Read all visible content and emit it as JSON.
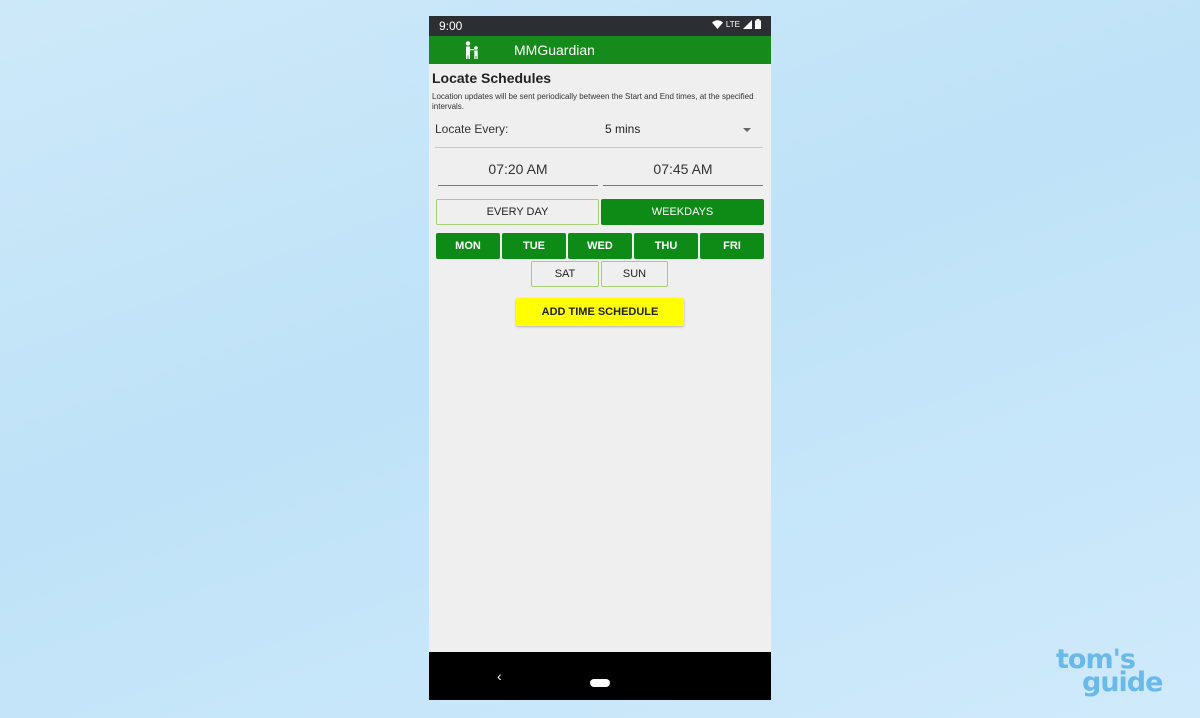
{
  "status_bar": {
    "time": "9:00",
    "network": "LTE"
  },
  "app_bar": {
    "title": "MMGuardian",
    "logo_icon": "family-icon"
  },
  "page": {
    "heading": "Locate Schedules",
    "description": "Location updates will be sent periodically between the Start and End times, at the specified intervals."
  },
  "locate": {
    "label": "Locate Every:",
    "value": "5 mins"
  },
  "times": {
    "start": "07:20 AM",
    "end": "07:45 AM"
  },
  "presets": {
    "every_day": {
      "label": "EVERY DAY",
      "selected": false
    },
    "weekdays": {
      "label": "WEEKDAYS",
      "selected": true
    }
  },
  "days": [
    {
      "label": "MON",
      "selected": true
    },
    {
      "label": "TUE",
      "selected": true
    },
    {
      "label": "WED",
      "selected": true
    },
    {
      "label": "THU",
      "selected": true
    },
    {
      "label": "FRI",
      "selected": true
    },
    {
      "label": "SAT",
      "selected": false
    },
    {
      "label": "SUN",
      "selected": false
    }
  ],
  "add_button": {
    "label": "ADD TIME SCHEDULE"
  },
  "nav_bar": {
    "back": "‹"
  },
  "watermark": {
    "line1": "tom's",
    "line2": "guide"
  },
  "colors": {
    "app_bar": "#168a1a",
    "selected": "#0d8b16",
    "accent_button": "#ffff00",
    "watermark": "#69b9ea"
  }
}
